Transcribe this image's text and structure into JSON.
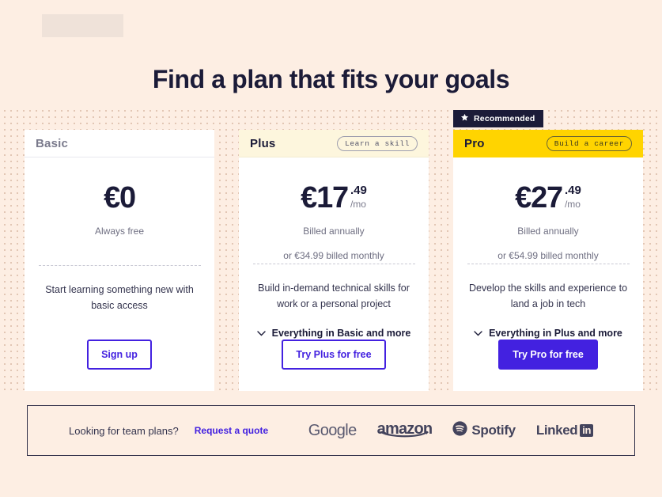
{
  "page": {
    "background_color": "#fdeee3",
    "heading": "Find a plan that fits your goals",
    "logo_placeholder_name": "brand-logo-placeholder"
  },
  "accent": {
    "indigo": "#4321e0",
    "yellow": "#ffd400",
    "navy": "#1b1b38",
    "cream": "#fdf6dd"
  },
  "plans": [
    {
      "id": "basic",
      "name": "Basic",
      "tagline": "",
      "recommended_label": "",
      "price_currency_amount": "€0",
      "price_cents": "",
      "price_period": "",
      "billing_line": "Always free",
      "billing_sub": "",
      "description": "Start learning something new with basic access",
      "expand_label": "",
      "cta_label": "Sign up",
      "cta_style": "outline"
    },
    {
      "id": "plus",
      "name": "Plus",
      "tagline": "Learn a skill",
      "recommended_label": "",
      "price_currency_amount": "€17",
      "price_cents": ".49",
      "price_period": "/mo",
      "billing_line": "Billed annually",
      "billing_sub": "or €34.99 billed monthly",
      "description": "Build in-demand technical skills for work or a personal project",
      "expand_label": "Everything in Basic and more",
      "cta_label": "Try Plus for free",
      "cta_style": "outline"
    },
    {
      "id": "pro",
      "name": "Pro",
      "tagline": "Build a career",
      "recommended_label": "Recommended",
      "price_currency_amount": "€27",
      "price_cents": ".49",
      "price_period": "/mo",
      "billing_line": "Billed annually",
      "billing_sub": "or €54.99 billed monthly",
      "description": "Develop the skills and experience to land a job in tech",
      "expand_label": "Everything in Plus and more",
      "cta_label": "Try Pro for free",
      "cta_style": "filled"
    }
  ],
  "footer": {
    "question": "Looking for team plans?",
    "quote_link": "Request a quote",
    "logos": [
      {
        "name": "google-logo",
        "text": "Google"
      },
      {
        "name": "amazon-logo",
        "text": "amazon"
      },
      {
        "name": "spotify-logo",
        "text": "Spotify"
      },
      {
        "name": "linkedin-logo",
        "text": "Linked",
        "suffix": "in"
      }
    ]
  },
  "icons": {
    "star": "star-icon",
    "chevron_down": "chevron-down-icon"
  }
}
